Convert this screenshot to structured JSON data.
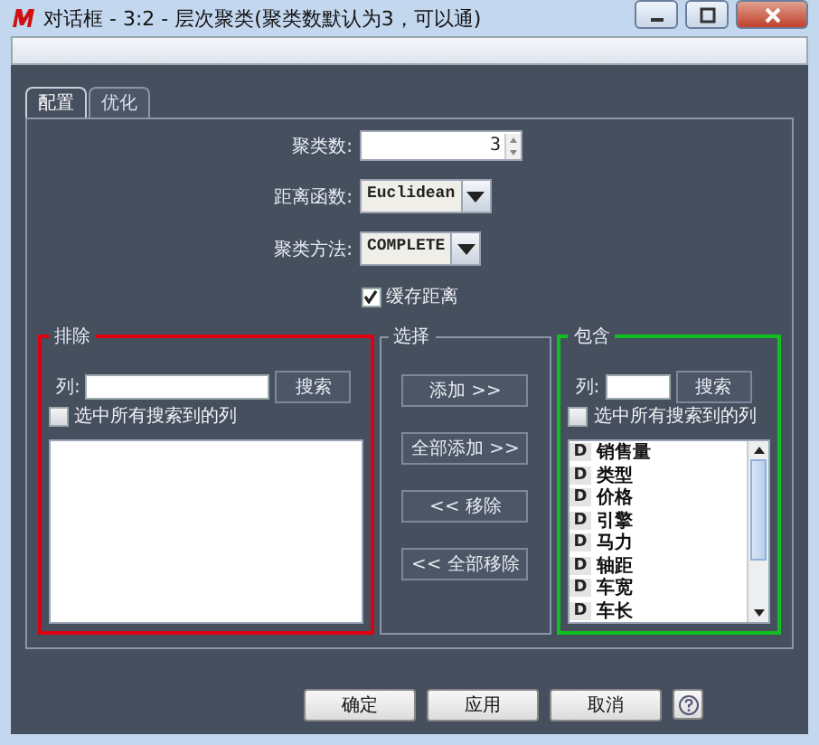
{
  "window": {
    "title": "对话框 - 3:2 - 层次聚类(聚类数默认为3，可以通)"
  },
  "tabs": [
    {
      "label": "配置",
      "selected": true
    },
    {
      "label": "优化",
      "selected": false
    }
  ],
  "form": {
    "cluster_count": {
      "label": "聚类数:",
      "value": "3"
    },
    "distance": {
      "label": "距离函数:",
      "value": "Euclidean"
    },
    "method": {
      "label": "聚类方法:",
      "value": "COMPLETE"
    },
    "cache": {
      "label": "缓存距离",
      "checked": true
    }
  },
  "exclude": {
    "title": "排除",
    "search_label": "列:",
    "search_button": "搜索",
    "select_all": {
      "label": "选中所有搜索到的列",
      "checked": false
    }
  },
  "select": {
    "title": "选择",
    "buttons": [
      "添加 >>",
      "全部添加 >>",
      "<< 移除",
      "<< 全部移除"
    ]
  },
  "include": {
    "title": "包含",
    "search_label": "列:",
    "search_button": "搜索",
    "select_all": {
      "label": "选中所有搜索到的列",
      "checked": false
    },
    "items": [
      {
        "type": "D",
        "name": "销售量"
      },
      {
        "type": "D",
        "name": "类型"
      },
      {
        "type": "D",
        "name": "价格"
      },
      {
        "type": "D",
        "name": "引擎"
      },
      {
        "type": "D",
        "name": "马力"
      },
      {
        "type": "D",
        "name": "轴距"
      },
      {
        "type": "D",
        "name": "车宽"
      },
      {
        "type": "D",
        "name": "车长"
      }
    ]
  },
  "buttons": [
    "确定",
    "应用",
    "取消"
  ]
}
